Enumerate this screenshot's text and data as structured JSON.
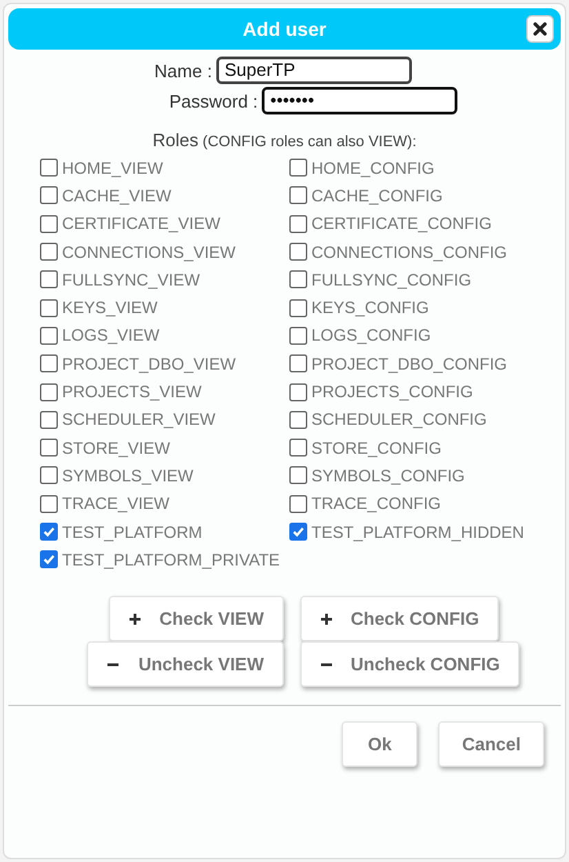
{
  "dialog": {
    "title": "Add user"
  },
  "fields": [
    {
      "label": "Name :",
      "value": "SuperTP",
      "focused": false
    },
    {
      "label": "Password :",
      "value": "•••••••",
      "focused": true
    }
  ],
  "roles_heading": {
    "label": "Roles",
    "note": "(CONFIG roles can also VIEW):"
  },
  "roles": [
    {
      "label": "HOME_VIEW",
      "checked": false
    },
    {
      "label": "HOME_CONFIG",
      "checked": false
    },
    {
      "label": "CACHE_VIEW",
      "checked": false
    },
    {
      "label": "CACHE_CONFIG",
      "checked": false
    },
    {
      "label": "CERTIFICATE_VIEW",
      "checked": false
    },
    {
      "label": "CERTIFICATE_CONFIG",
      "checked": false
    },
    {
      "label": "CONNECTIONS_VIEW",
      "checked": false
    },
    {
      "label": "CONNECTIONS_CONFIG",
      "checked": false
    },
    {
      "label": "FULLSYNC_VIEW",
      "checked": false
    },
    {
      "label": "FULLSYNC_CONFIG",
      "checked": false
    },
    {
      "label": "KEYS_VIEW",
      "checked": false
    },
    {
      "label": "KEYS_CONFIG",
      "checked": false
    },
    {
      "label": "LOGS_VIEW",
      "checked": false
    },
    {
      "label": "LOGS_CONFIG",
      "checked": false
    },
    {
      "label": "PROJECT_DBO_VIEW",
      "checked": false
    },
    {
      "label": "PROJECT_DBO_CONFIG",
      "checked": false
    },
    {
      "label": "PROJECTS_VIEW",
      "checked": false
    },
    {
      "label": "PROJECTS_CONFIG",
      "checked": false
    },
    {
      "label": "SCHEDULER_VIEW",
      "checked": false
    },
    {
      "label": "SCHEDULER_CONFIG",
      "checked": false
    },
    {
      "label": "STORE_VIEW",
      "checked": false
    },
    {
      "label": "STORE_CONFIG",
      "checked": false
    },
    {
      "label": "SYMBOLS_VIEW",
      "checked": false
    },
    {
      "label": "SYMBOLS_CONFIG",
      "checked": false
    },
    {
      "label": "TRACE_VIEW",
      "checked": false
    },
    {
      "label": "TRACE_CONFIG",
      "checked": false
    },
    {
      "label": "TEST_PLATFORM",
      "checked": true
    },
    {
      "label": "TEST_PLATFORM_HIDDEN",
      "checked": true
    },
    {
      "label": "TEST_PLATFORM_PRIVATE",
      "checked": true
    }
  ],
  "bulk_buttons": [
    {
      "kind": "check",
      "label": "Check VIEW"
    },
    {
      "kind": "check",
      "label": "Check CONFIG"
    },
    {
      "kind": "uncheck",
      "label": "Uncheck VIEW"
    },
    {
      "kind": "uncheck",
      "label": "Uncheck CONFIG"
    }
  ],
  "footer_buttons": [
    "Ok",
    "Cancel"
  ]
}
